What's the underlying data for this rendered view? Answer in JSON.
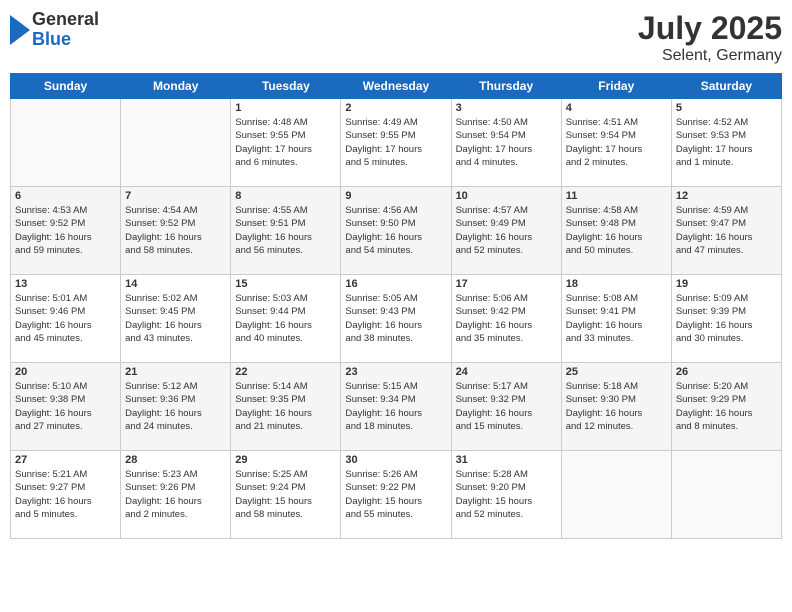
{
  "header": {
    "logo_general": "General",
    "logo_blue": "Blue",
    "title": "July 2025",
    "subtitle": "Selent, Germany"
  },
  "days_of_week": [
    "Sunday",
    "Monday",
    "Tuesday",
    "Wednesday",
    "Thursday",
    "Friday",
    "Saturday"
  ],
  "weeks": [
    [
      {
        "day": "",
        "info": ""
      },
      {
        "day": "",
        "info": ""
      },
      {
        "day": "1",
        "info": "Sunrise: 4:48 AM\nSunset: 9:55 PM\nDaylight: 17 hours\nand 6 minutes."
      },
      {
        "day": "2",
        "info": "Sunrise: 4:49 AM\nSunset: 9:55 PM\nDaylight: 17 hours\nand 5 minutes."
      },
      {
        "day": "3",
        "info": "Sunrise: 4:50 AM\nSunset: 9:54 PM\nDaylight: 17 hours\nand 4 minutes."
      },
      {
        "day": "4",
        "info": "Sunrise: 4:51 AM\nSunset: 9:54 PM\nDaylight: 17 hours\nand 2 minutes."
      },
      {
        "day": "5",
        "info": "Sunrise: 4:52 AM\nSunset: 9:53 PM\nDaylight: 17 hours\nand 1 minute."
      }
    ],
    [
      {
        "day": "6",
        "info": "Sunrise: 4:53 AM\nSunset: 9:52 PM\nDaylight: 16 hours\nand 59 minutes."
      },
      {
        "day": "7",
        "info": "Sunrise: 4:54 AM\nSunset: 9:52 PM\nDaylight: 16 hours\nand 58 minutes."
      },
      {
        "day": "8",
        "info": "Sunrise: 4:55 AM\nSunset: 9:51 PM\nDaylight: 16 hours\nand 56 minutes."
      },
      {
        "day": "9",
        "info": "Sunrise: 4:56 AM\nSunset: 9:50 PM\nDaylight: 16 hours\nand 54 minutes."
      },
      {
        "day": "10",
        "info": "Sunrise: 4:57 AM\nSunset: 9:49 PM\nDaylight: 16 hours\nand 52 minutes."
      },
      {
        "day": "11",
        "info": "Sunrise: 4:58 AM\nSunset: 9:48 PM\nDaylight: 16 hours\nand 50 minutes."
      },
      {
        "day": "12",
        "info": "Sunrise: 4:59 AM\nSunset: 9:47 PM\nDaylight: 16 hours\nand 47 minutes."
      }
    ],
    [
      {
        "day": "13",
        "info": "Sunrise: 5:01 AM\nSunset: 9:46 PM\nDaylight: 16 hours\nand 45 minutes."
      },
      {
        "day": "14",
        "info": "Sunrise: 5:02 AM\nSunset: 9:45 PM\nDaylight: 16 hours\nand 43 minutes."
      },
      {
        "day": "15",
        "info": "Sunrise: 5:03 AM\nSunset: 9:44 PM\nDaylight: 16 hours\nand 40 minutes."
      },
      {
        "day": "16",
        "info": "Sunrise: 5:05 AM\nSunset: 9:43 PM\nDaylight: 16 hours\nand 38 minutes."
      },
      {
        "day": "17",
        "info": "Sunrise: 5:06 AM\nSunset: 9:42 PM\nDaylight: 16 hours\nand 35 minutes."
      },
      {
        "day": "18",
        "info": "Sunrise: 5:08 AM\nSunset: 9:41 PM\nDaylight: 16 hours\nand 33 minutes."
      },
      {
        "day": "19",
        "info": "Sunrise: 5:09 AM\nSunset: 9:39 PM\nDaylight: 16 hours\nand 30 minutes."
      }
    ],
    [
      {
        "day": "20",
        "info": "Sunrise: 5:10 AM\nSunset: 9:38 PM\nDaylight: 16 hours\nand 27 minutes."
      },
      {
        "day": "21",
        "info": "Sunrise: 5:12 AM\nSunset: 9:36 PM\nDaylight: 16 hours\nand 24 minutes."
      },
      {
        "day": "22",
        "info": "Sunrise: 5:14 AM\nSunset: 9:35 PM\nDaylight: 16 hours\nand 21 minutes."
      },
      {
        "day": "23",
        "info": "Sunrise: 5:15 AM\nSunset: 9:34 PM\nDaylight: 16 hours\nand 18 minutes."
      },
      {
        "day": "24",
        "info": "Sunrise: 5:17 AM\nSunset: 9:32 PM\nDaylight: 16 hours\nand 15 minutes."
      },
      {
        "day": "25",
        "info": "Sunrise: 5:18 AM\nSunset: 9:30 PM\nDaylight: 16 hours\nand 12 minutes."
      },
      {
        "day": "26",
        "info": "Sunrise: 5:20 AM\nSunset: 9:29 PM\nDaylight: 16 hours\nand 8 minutes."
      }
    ],
    [
      {
        "day": "27",
        "info": "Sunrise: 5:21 AM\nSunset: 9:27 PM\nDaylight: 16 hours\nand 5 minutes."
      },
      {
        "day": "28",
        "info": "Sunrise: 5:23 AM\nSunset: 9:26 PM\nDaylight: 16 hours\nand 2 minutes."
      },
      {
        "day": "29",
        "info": "Sunrise: 5:25 AM\nSunset: 9:24 PM\nDaylight: 15 hours\nand 58 minutes."
      },
      {
        "day": "30",
        "info": "Sunrise: 5:26 AM\nSunset: 9:22 PM\nDaylight: 15 hours\nand 55 minutes."
      },
      {
        "day": "31",
        "info": "Sunrise: 5:28 AM\nSunset: 9:20 PM\nDaylight: 15 hours\nand 52 minutes."
      },
      {
        "day": "",
        "info": ""
      },
      {
        "day": "",
        "info": ""
      }
    ]
  ]
}
